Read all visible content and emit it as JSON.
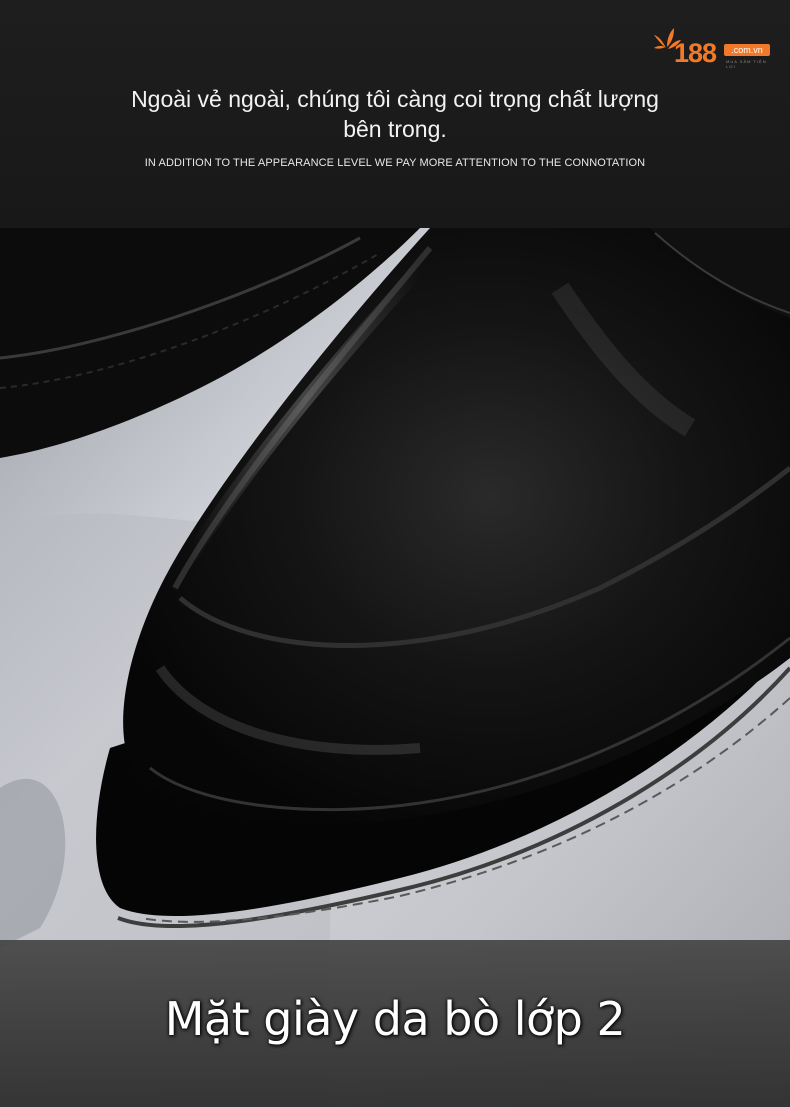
{
  "logo": {
    "number": "188",
    "domain": ".com.vn",
    "tagline": "MUA SẮM TIỆN LỢI"
  },
  "headline": {
    "vietnamese": "Ngoài vẻ ngoài, chúng tôi càng coi trọng chất lượng bên trong.",
    "english": "IN ADDITION TO THE APPEARANCE LEVEL WE PAY MORE ATTENTION TO THE CONNOTATION"
  },
  "caption": "Mặt giày da bò lớp 2",
  "colors": {
    "brand": "#f07a2a",
    "background": "#1c1c1c"
  }
}
